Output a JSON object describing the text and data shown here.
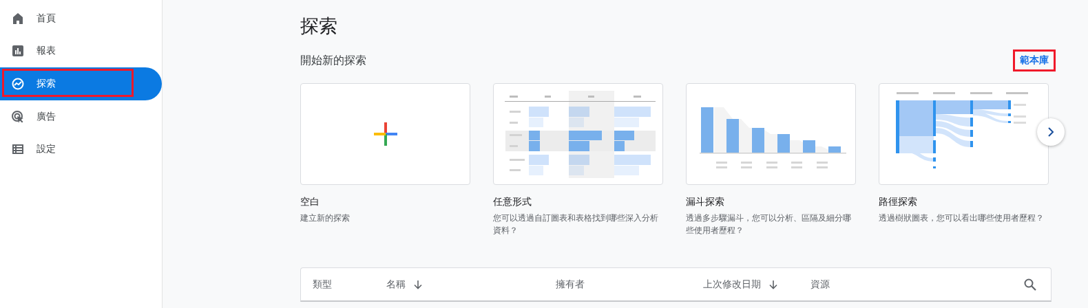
{
  "sidebar": {
    "items": [
      {
        "label": "首頁",
        "selected": false,
        "highlighted": false
      },
      {
        "label": "報表",
        "selected": false,
        "highlighted": false
      },
      {
        "label": "探索",
        "selected": true,
        "highlighted": true
      },
      {
        "label": "廣告",
        "selected": false,
        "highlighted": false
      },
      {
        "label": "設定",
        "selected": false,
        "highlighted": false
      }
    ]
  },
  "page": {
    "title": "探索",
    "section_title": "開始新的探索",
    "library_link": {
      "label": "範本庫",
      "highlighted": true
    }
  },
  "templates": [
    {
      "kind": "blank",
      "title": "空白",
      "description": "建立新的探索"
    },
    {
      "kind": "freeform",
      "title": "任意形式",
      "description": "您可以透過自訂圖表和表格找到哪些深入分析資料？"
    },
    {
      "kind": "funnel",
      "title": "漏斗探索",
      "description": "透過多步驟漏斗，您可以分析、區隔及細分哪些使用者歷程？"
    },
    {
      "kind": "path",
      "title": "路徑探索",
      "description": "透過樹狀圖表，您可以看出哪些使用者歷程？"
    }
  ],
  "table": {
    "columns": [
      {
        "label": "類型",
        "sort_arrow": false
      },
      {
        "label": "名稱",
        "sort_arrow": true
      },
      {
        "label": "擁有者",
        "sort_arrow": false
      },
      {
        "label": "上次修改日期",
        "sort_arrow": true
      },
      {
        "label": "資源",
        "sort_arrow": false
      }
    ]
  }
}
